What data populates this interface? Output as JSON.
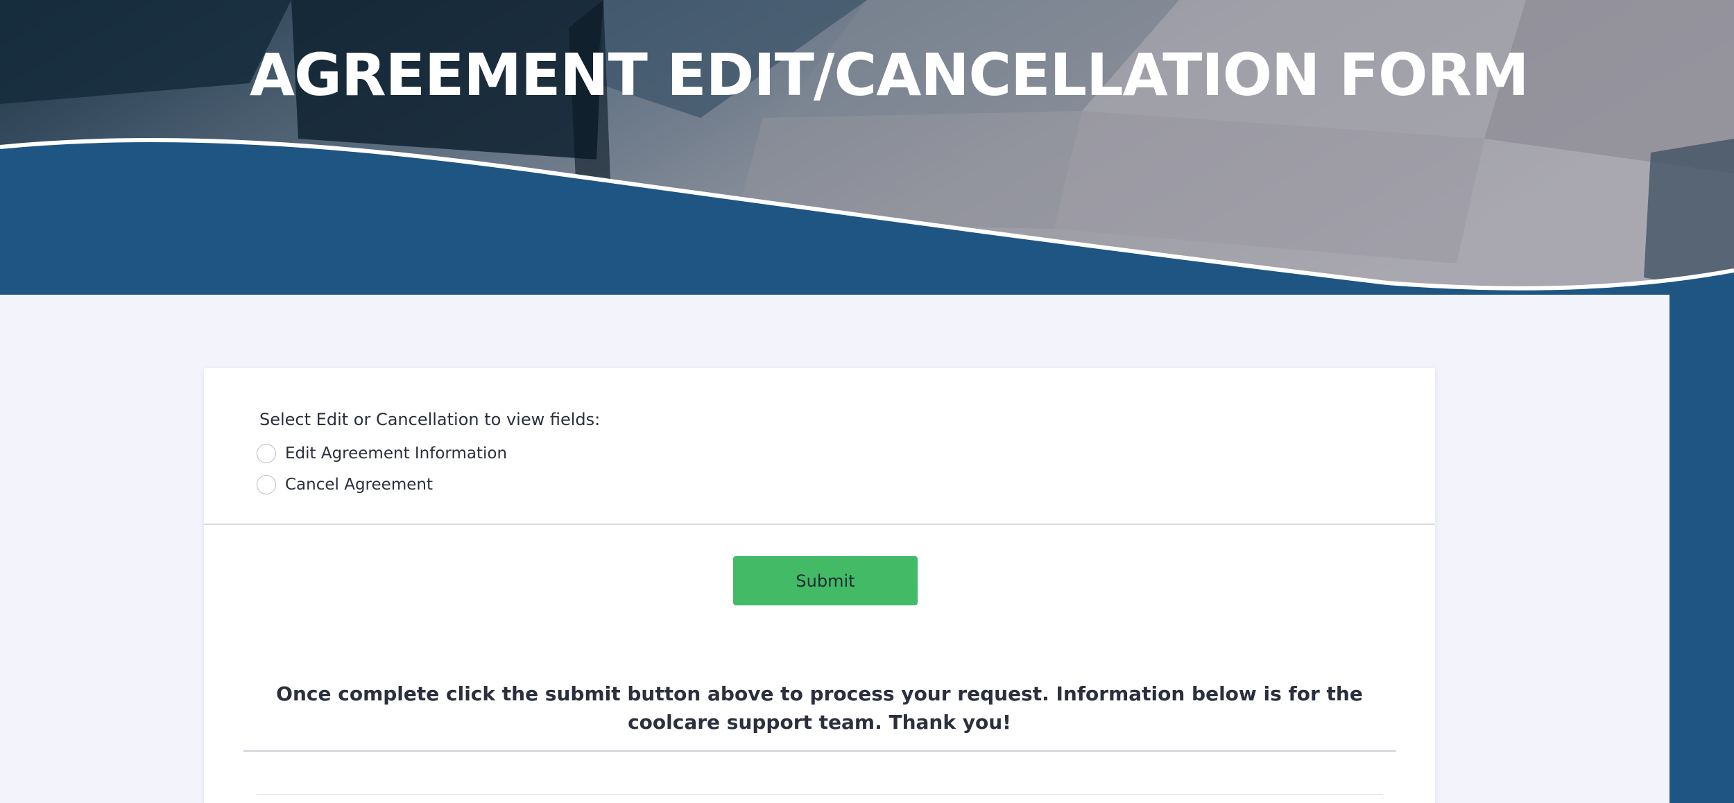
{
  "header": {
    "title": "AGREEMENT EDIT/CANCELLATION FORM"
  },
  "form": {
    "question_label": "Select Edit or Cancellation to view fields:",
    "options": [
      {
        "label": "Edit Agreement Information",
        "selected": false
      },
      {
        "label": "Cancel Agreement",
        "selected": false
      }
    ],
    "submit_label": "Submit",
    "notice": "Once complete click the submit button above to process your request. Information below is for the coolcare support team. Thank you!"
  },
  "colors": {
    "header_blue": "#1f5582",
    "page_background": "#f2f3fb",
    "submit_green": "#43bb66",
    "text_dark": "#2b2f3e"
  }
}
